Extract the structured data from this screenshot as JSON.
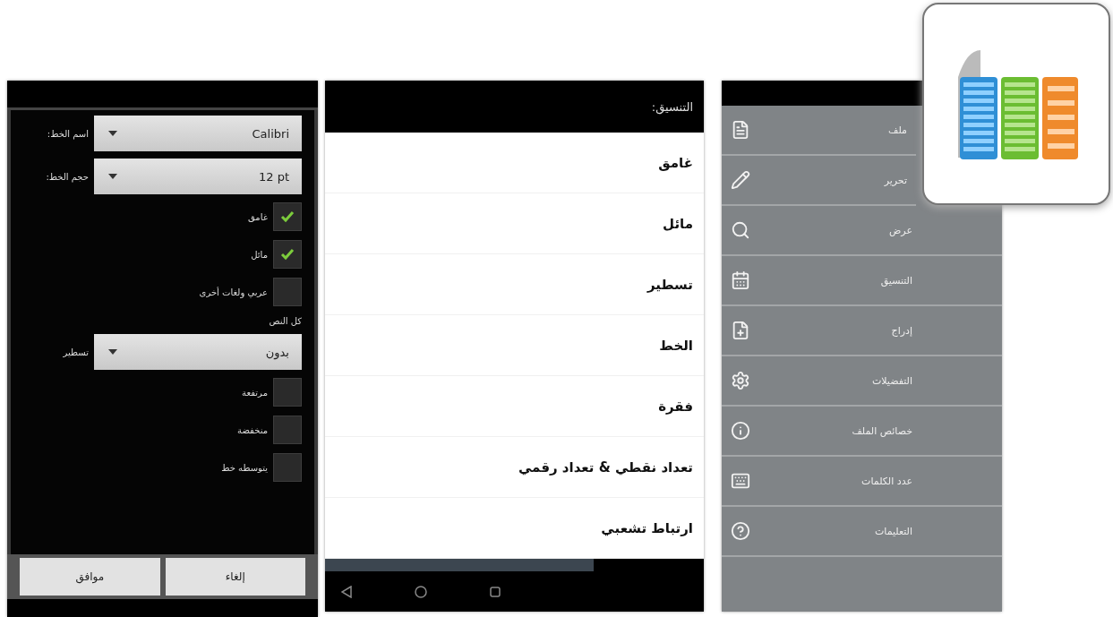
{
  "font_dialog": {
    "fields": [
      {
        "label": "اسم الخط:",
        "value": "Calibri"
      },
      {
        "label": "حجم الخط:",
        "value": "12 pt"
      }
    ],
    "options": [
      {
        "label": "غامق",
        "checked": true
      },
      {
        "label": "مائل",
        "checked": true
      },
      {
        "label": "عربي ولغات أخرى",
        "checked": false
      }
    ],
    "section_label": "كل النص",
    "underline": {
      "label": "تسطير",
      "value": "بدون"
    },
    "effects": [
      {
        "label": "مرتفعة",
        "checked": false
      },
      {
        "label": "منخفضة",
        "checked": false
      },
      {
        "label": "يتوسطه خط",
        "checked": false
      }
    ],
    "buttons": [
      "إلغاء",
      "موافق"
    ]
  },
  "format_menu": {
    "title": "التنسيق:",
    "items": [
      "غامق",
      "مائل",
      "تسطير",
      "الخط",
      "فقرة",
      "تعداد نقطي & تعداد رقمي",
      "ارتباط تشعبي"
    ]
  },
  "main_menu": {
    "items": [
      "ملف",
      "تحرير",
      "عرض",
      "التنسيق",
      "إدراج",
      "التفضيلات",
      "خصائص الملف",
      "عدد الكلمات",
      "التعليمات"
    ]
  }
}
